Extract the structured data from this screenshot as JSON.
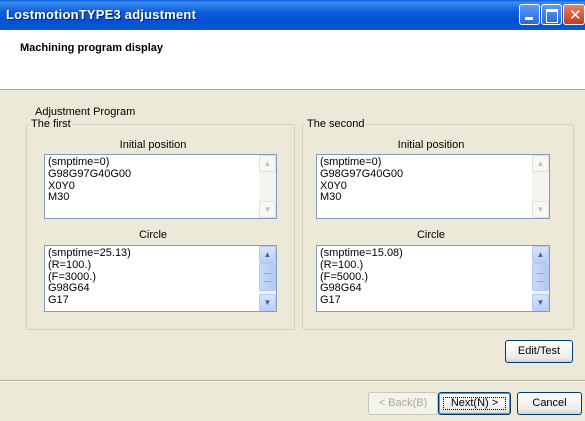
{
  "window": {
    "title": "LostmotionTYPE3 adjustment",
    "controls": [
      "minimize",
      "maximize",
      "close"
    ]
  },
  "header": {
    "title": "Machining program display"
  },
  "section_label": "Adjustment Program",
  "first": {
    "legend": "The first",
    "initial_label": "Initial position",
    "initial_lines": "(smptime=0)\nG98G97G40G00\nX0Y0\nM30",
    "circle_label": "Circle",
    "circle_lines": "(smptime=25.13)\n(R=100.)\n(F=3000.)\nG98G64\nG17"
  },
  "second": {
    "legend": "The second",
    "initial_label": "Initial position",
    "initial_lines": "(smptime=0)\nG98G97G40G00\nX0Y0\nM30",
    "circle_label": "Circle",
    "circle_lines": "(smptime=15.08)\n(R=100.)\n(F=5000.)\nG98G64\nG17"
  },
  "buttons": {
    "edit_test": "Edit/Test",
    "back": "< Back(B)",
    "next": "Next(N) >",
    "cancel": "Cancel"
  },
  "colors": {
    "titlebar": "#0450d2",
    "dialog_bg": "#ece9d8",
    "listbox_border": "#7f9db9"
  }
}
